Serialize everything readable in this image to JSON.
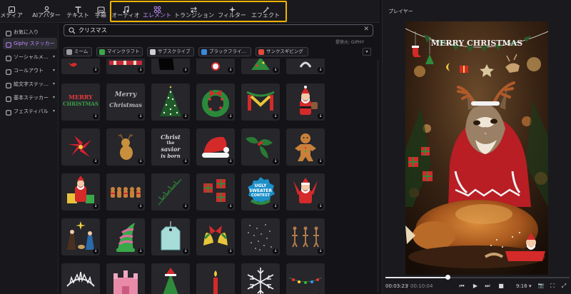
{
  "toolbar": {
    "tools": [
      {
        "id": "media",
        "label": "メディア",
        "icon": "media-icon"
      },
      {
        "id": "ai-avatar",
        "label": "AIアバター",
        "icon": "ai-avatar-icon"
      },
      {
        "id": "text",
        "label": "テキスト",
        "icon": "text-icon"
      },
      {
        "id": "subtitles",
        "label": "字幕",
        "icon": "subtitles-icon"
      },
      {
        "id": "audio",
        "label": "オーディオ",
        "icon": "music-note-icon"
      },
      {
        "id": "elements",
        "label": "エレメント",
        "icon": "elements-icon",
        "active": true
      },
      {
        "id": "transitions",
        "label": "トランジション",
        "icon": "transition-arrows-icon"
      },
      {
        "id": "filters",
        "label": "フィルター",
        "icon": "sparkle-icon"
      },
      {
        "id": "effects",
        "label": "エフェクト",
        "icon": "effects-wand-icon"
      }
    ],
    "highlight_color": "#f0b400",
    "accent_color": "#c08cff"
  },
  "sidebar": {
    "items": [
      {
        "label": "お気に入り",
        "icon": "bookmark-icon"
      },
      {
        "label": "Giphy ステッカー",
        "icon": "giphy-icon",
        "active": true
      },
      {
        "label": "ソーシャルメ…",
        "icon": "social-media-icon",
        "caret": true
      },
      {
        "label": "コールアウト",
        "icon": "callout-icon",
        "caret": true
      },
      {
        "label": "絵文字ステッ…",
        "icon": "emoji-icon",
        "caret": true
      },
      {
        "label": "基本ステッカー",
        "icon": "basic-sticker-icon",
        "caret": true
      },
      {
        "label": "フェスティバル",
        "icon": "festival-icon",
        "caret": true
      }
    ],
    "caret_glyph": "▾"
  },
  "search": {
    "value": "クリスマス",
    "clear_glyph": "✕"
  },
  "provider_label": "提供元: GIPHY",
  "chips": [
    {
      "label": "ミーム",
      "icon": "meme-icon"
    },
    {
      "label": "マインクラフト",
      "icon": "minecraft-icon"
    },
    {
      "label": "サブスクライブ",
      "icon": "subscribe-icon"
    },
    {
      "label": "ブラックフライ…",
      "icon": "black-friday-icon"
    },
    {
      "label": "サンクスギビング",
      "icon": "thanksgiving-icon"
    }
  ],
  "chip_expand_glyph": "▾",
  "stickers": {
    "download_glyph": "↓",
    "text_stickers": {
      "merry_christmas_1": [
        "MERRY",
        "CHRISTMAS"
      ],
      "merry_christmas_2": [
        "Merry",
        "Christmas"
      ],
      "christ_savior": [
        "Christ",
        "the",
        "savior",
        "is born"
      ],
      "ugly_sweater": [
        "UGLY",
        "SWEATER",
        "CONTEST"
      ]
    }
  },
  "player": {
    "title": "プレイヤー",
    "banner_text": "MERRY CHRISTMAS",
    "time_current": "00:03:23",
    "time_separator": "/",
    "time_total": "00:10:04",
    "progress": 0.336,
    "aspect_ratio": "9:16",
    "ratio_caret": "▾",
    "controls": {
      "prev": "⏮",
      "play": "▶",
      "next": "⏭",
      "stop": "■",
      "snapshot": "📷",
      "crop": "⛶",
      "fullscreen": "⤢"
    }
  }
}
